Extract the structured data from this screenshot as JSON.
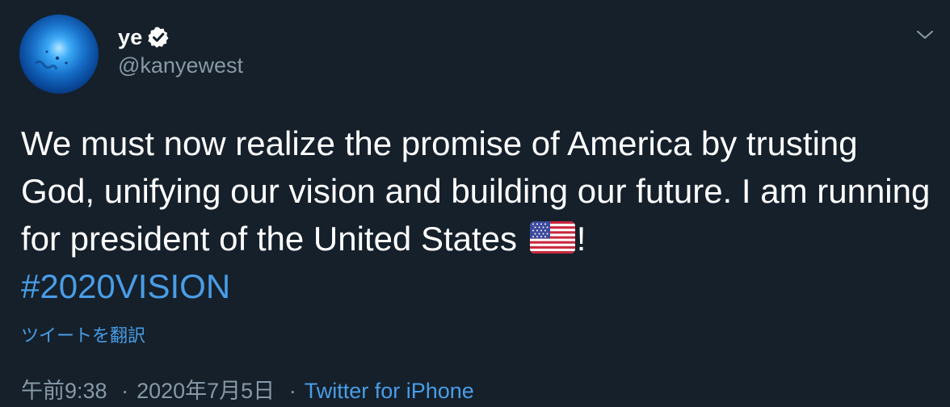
{
  "user": {
    "display_name": "ye",
    "handle": "@kanyewest",
    "verified": true
  },
  "icons": {
    "verified": "verified-badge-icon",
    "menu": "chevron-down-icon",
    "flag": "us-flag-emoji"
  },
  "tweet": {
    "text_part1": "We must now realize the promise of America by trusting God, unifying our vision and building our future. I am running for president of the United States ",
    "text_part2": "!",
    "hashtag": "#2020VISION"
  },
  "translate_label": "ツイートを翻訳",
  "meta": {
    "time": "午前9:38",
    "separator": "·",
    "date": "2020年7月5日",
    "source": "Twitter for iPhone"
  },
  "colors": {
    "background": "#15202b",
    "link": "#4a9de6",
    "secondary_text": "#8899a6"
  }
}
